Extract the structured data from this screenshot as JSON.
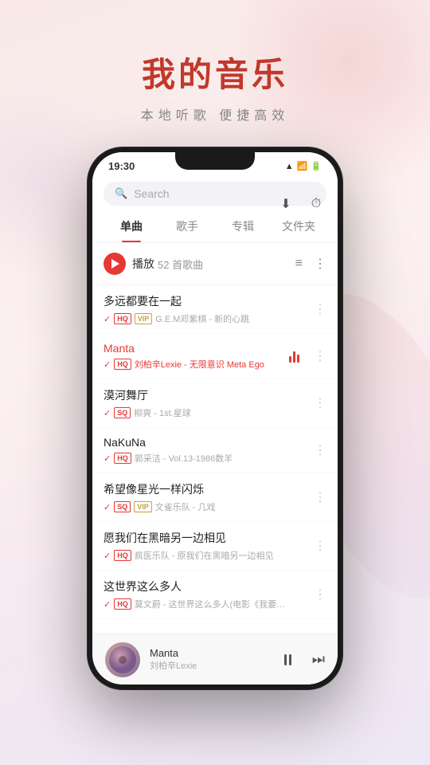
{
  "app": {
    "title": "我的音乐",
    "subtitle": "本地听歌  便捷高效"
  },
  "status_bar": {
    "time": "19:30"
  },
  "search": {
    "placeholder": "Search"
  },
  "tabs": [
    {
      "id": "single",
      "label": "单曲",
      "active": true
    },
    {
      "id": "artist",
      "label": "歌手",
      "active": false
    },
    {
      "id": "album",
      "label": "专辑",
      "active": false
    },
    {
      "id": "folder",
      "label": "文件夹",
      "active": false
    }
  ],
  "play_all": {
    "label": "播放",
    "count": "52 首歌曲"
  },
  "songs": [
    {
      "name": "多远都要在一起",
      "badges": [
        "HQ",
        "VIP"
      ],
      "artist": "G.E.M邓紫棋 - 新的心跳",
      "active": false,
      "equalizer": false
    },
    {
      "name": "Manta",
      "badges": [
        "HQ"
      ],
      "artist": "刘柏辛Lexie - 无限意识 Meta Ego",
      "active": true,
      "equalizer": true
    },
    {
      "name": "漠河舞厅",
      "badges": [
        "SQ"
      ],
      "artist": "柳爽 - 1st.星球",
      "active": false,
      "equalizer": false
    },
    {
      "name": "NaKuNa",
      "badges": [
        "HQ"
      ],
      "artist": "郭采洁 - Vol.13-1986数羊",
      "active": false,
      "equalizer": false
    },
    {
      "name": "希望像星光一样闪烁",
      "badges": [
        "SQ",
        "VIP"
      ],
      "artist": "文雀乐队 - 几戏",
      "active": false,
      "equalizer": false
    },
    {
      "name": "愿我们在黑暗另一边相见",
      "badges": [
        "HQ"
      ],
      "artist": "疯医乐队 - 原我们在黑暗另一边相见",
      "active": false,
      "equalizer": false
    },
    {
      "name": "这世界这么多人",
      "badges": [
        "HQ"
      ],
      "artist": "莫文蔚 - 这世界这么多人(电影《我要我们在...",
      "active": false,
      "equalizer": false
    }
  ],
  "mini_player": {
    "song_name": "Manta",
    "artist": "刘柏辛Lexie"
  },
  "icons": {
    "search": "🔍",
    "download": "⬇",
    "clock": "⏱",
    "more_list": "≡",
    "more_dots": "⋮",
    "next": "⏭"
  }
}
